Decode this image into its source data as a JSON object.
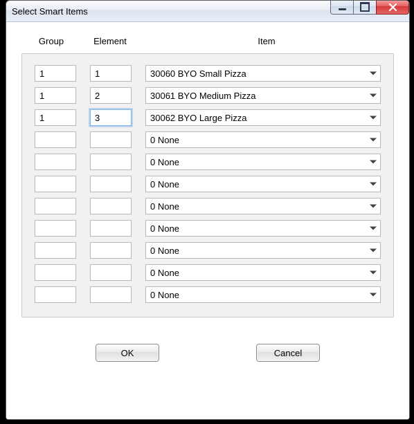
{
  "window": {
    "title": "Select Smart Items"
  },
  "columns": {
    "group": "Group",
    "element": "Element",
    "item": "Item"
  },
  "rows": [
    {
      "group": "1",
      "element": "1",
      "item": "30060 BYO Small Pizza",
      "focused": false
    },
    {
      "group": "1",
      "element": "2",
      "item": "30061 BYO Medium Pizza",
      "focused": false
    },
    {
      "group": "1",
      "element": "3",
      "item": "30062 BYO Large Pizza",
      "focused": true
    },
    {
      "group": "",
      "element": "",
      "item": "0 None",
      "focused": false
    },
    {
      "group": "",
      "element": "",
      "item": "0 None",
      "focused": false
    },
    {
      "group": "",
      "element": "",
      "item": "0 None",
      "focused": false
    },
    {
      "group": "",
      "element": "",
      "item": "0 None",
      "focused": false
    },
    {
      "group": "",
      "element": "",
      "item": "0 None",
      "focused": false
    },
    {
      "group": "",
      "element": "",
      "item": "0 None",
      "focused": false
    },
    {
      "group": "",
      "element": "",
      "item": "0 None",
      "focused": false
    },
    {
      "group": "",
      "element": "",
      "item": "0 None",
      "focused": false
    }
  ],
  "buttons": {
    "ok": "OK",
    "cancel": "Cancel"
  }
}
